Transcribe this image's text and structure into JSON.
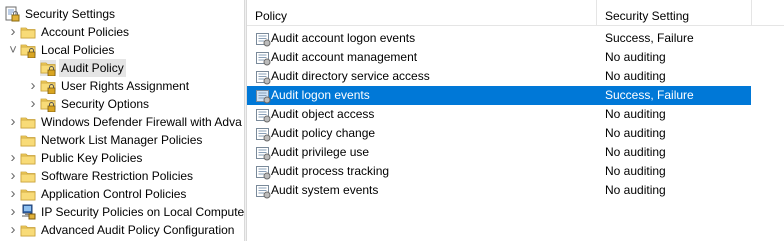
{
  "tree": {
    "root": {
      "label": "Security Settings",
      "icon": "security-settings-icon"
    },
    "items": [
      {
        "label": "Account Policies",
        "icon": "folder-icon",
        "expander": "collapsed"
      },
      {
        "label": "Local Policies",
        "icon": "lock-folder-icon",
        "expander": "expanded"
      },
      {
        "label": "Audit Policy",
        "icon": "lock-folder-icon",
        "expander": "none",
        "selected": true
      },
      {
        "label": "User Rights Assignment",
        "icon": "lock-folder-icon",
        "expander": "collapsed"
      },
      {
        "label": "Security Options",
        "icon": "lock-folder-icon",
        "expander": "collapsed"
      },
      {
        "label": "Windows Defender Firewall with Adva",
        "icon": "folder-icon",
        "expander": "collapsed"
      },
      {
        "label": "Network List Manager Policies",
        "icon": "folder-icon",
        "expander": "none"
      },
      {
        "label": "Public Key Policies",
        "icon": "folder-icon",
        "expander": "collapsed"
      },
      {
        "label": "Software Restriction Policies",
        "icon": "folder-icon",
        "expander": "collapsed"
      },
      {
        "label": "Application Control Policies",
        "icon": "folder-icon",
        "expander": "collapsed"
      },
      {
        "label": "IP Security Policies on Local Compute",
        "icon": "ip-security-icon",
        "expander": "collapsed"
      },
      {
        "label": "Advanced Audit Policy Configuration",
        "icon": "folder-icon",
        "expander": "collapsed"
      }
    ]
  },
  "list": {
    "columns": {
      "policy": "Policy",
      "setting": "Security Setting"
    },
    "rows": [
      {
        "policy": "Audit account logon events",
        "setting": "Success, Failure"
      },
      {
        "policy": "Audit account management",
        "setting": "No auditing"
      },
      {
        "policy": "Audit directory service access",
        "setting": "No auditing"
      },
      {
        "policy": "Audit logon events",
        "setting": "Success, Failure",
        "selected": true
      },
      {
        "policy": "Audit object access",
        "setting": "No auditing"
      },
      {
        "policy": "Audit policy change",
        "setting": "No auditing"
      },
      {
        "policy": "Audit privilege use",
        "setting": "No auditing"
      },
      {
        "policy": "Audit process tracking",
        "setting": "No auditing"
      },
      {
        "policy": "Audit system events",
        "setting": "No auditing"
      }
    ]
  },
  "colors": {
    "selection": "#0078d7",
    "tree_selection": "#e5e5e5",
    "folder": "#f0c94a",
    "lock": "#d9a521"
  }
}
